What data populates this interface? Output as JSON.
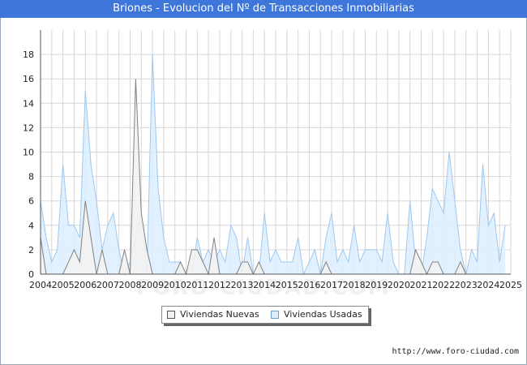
{
  "title": "Briones - Evolucion del Nº de Transacciones Inmobiliarias",
  "credit": "http://www.foro-ciudad.com",
  "watermark": "FORO-CIUDAD.COM",
  "colors": {
    "titlebar": "#3f76d9",
    "nuevas_fill": "#f2f2f2",
    "nuevas_line": "#808080",
    "usadas_fill": "#ddeeff",
    "usadas_line": "#9ec7ee",
    "grid": "#d7d7d7"
  },
  "chart_data": {
    "type": "area",
    "title": "Briones - Evolucion del Nº de Transacciones Inmobiliarias",
    "xlabel": "",
    "ylabel": "",
    "ylim": [
      0,
      20
    ],
    "yticks": [
      0,
      2,
      4,
      6,
      8,
      10,
      12,
      14,
      16,
      18
    ],
    "xlim": [
      2004,
      2025
    ],
    "xticks": [
      "2004",
      "2005",
      "2006",
      "2007",
      "2008",
      "2009",
      "2010",
      "2011",
      "2012",
      "2013",
      "2014",
      "2015",
      "2016",
      "2017",
      "2018",
      "2019",
      "2020",
      "2021",
      "2022",
      "2023",
      "2024",
      "2025"
    ],
    "grid": true,
    "legend_position": "bottom-center",
    "period": "quarterly",
    "series": [
      {
        "name": "Viviendas Nuevas",
        "values": [
          3,
          0,
          0,
          0,
          0,
          1,
          2,
          1,
          6,
          3,
          0,
          2,
          0,
          0,
          0,
          2,
          0,
          16,
          5,
          2,
          0,
          0,
          0,
          0,
          0,
          1,
          0,
          2,
          2,
          1,
          0,
          3,
          0,
          0,
          0,
          0,
          1,
          1,
          0,
          1,
          0,
          0,
          0,
          0,
          0,
          0,
          0,
          0,
          0,
          0,
          0,
          1,
          0,
          0,
          0,
          0,
          0,
          0,
          0,
          0,
          0,
          0,
          0,
          0,
          0,
          0,
          0,
          2,
          1,
          0,
          1,
          1,
          0,
          0,
          0,
          1,
          0,
          0,
          0,
          0
        ]
      },
      {
        "name": "Viviendas Usadas",
        "values": [
          6,
          3,
          1,
          2,
          9,
          4,
          4,
          3,
          15,
          9,
          6,
          2,
          4,
          5,
          2,
          0,
          1,
          3,
          5,
          0,
          18,
          7,
          3,
          1,
          1,
          1,
          0,
          0,
          3,
          1,
          2,
          1,
          2,
          1,
          4,
          3,
          0,
          3,
          0,
          0,
          5,
          1,
          2,
          1,
          1,
          1,
          3,
          0,
          1,
          2,
          0,
          3,
          5,
          1,
          2,
          1,
          4,
          1,
          2,
          2,
          2,
          1,
          5,
          1,
          0,
          0,
          6,
          1,
          0,
          3,
          7,
          6,
          5,
          10,
          6,
          2,
          0,
          2,
          1,
          9,
          4,
          5,
          1,
          4
        ]
      }
    ]
  }
}
